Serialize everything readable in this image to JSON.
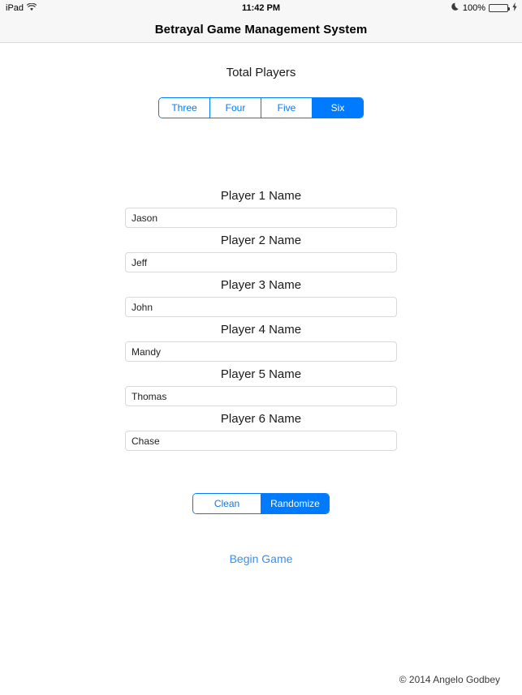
{
  "status_bar": {
    "device_label": "iPad",
    "wifi_icon": "wifi-icon",
    "time": "11:42 PM",
    "dnd_icon": "moon-icon",
    "battery_percent": "100%",
    "battery_level": 100,
    "charging_icon": "bolt-icon",
    "battery_color": "#4cd964"
  },
  "navbar": {
    "title": "Betrayal Game Management System"
  },
  "total_players": {
    "heading": "Total Players",
    "options": [
      {
        "label": "Three",
        "selected": false
      },
      {
        "label": "Four",
        "selected": false
      },
      {
        "label": "Five",
        "selected": false
      },
      {
        "label": "Six",
        "selected": true
      }
    ],
    "selected_value": "Six"
  },
  "players": [
    {
      "label": "Player 1 Name",
      "value": "Jason",
      "placeholder": ""
    },
    {
      "label": "Player 2 Name",
      "value": "Jeff",
      "placeholder": ""
    },
    {
      "label": "Player 3 Name",
      "value": "John",
      "placeholder": ""
    },
    {
      "label": "Player 4 Name",
      "value": "Mandy",
      "placeholder": ""
    },
    {
      "label": "Player 5 Name",
      "value": "Thomas",
      "placeholder": ""
    },
    {
      "label": "Player 6 Name",
      "value": "Chase",
      "placeholder": ""
    }
  ],
  "actions": {
    "options": [
      {
        "label": "Clean",
        "selected": false
      },
      {
        "label": "Randomize",
        "selected": true
      }
    ],
    "selected_value": "Randomize"
  },
  "begin_game": {
    "label": "Begin Game"
  },
  "footer": {
    "copyright": "© 2014 Angelo Godbey"
  },
  "theme": {
    "accent": "#007aff",
    "link": "#3a8df0",
    "chrome_bg": "#f7f7f7",
    "border": "#d9d9d9"
  }
}
